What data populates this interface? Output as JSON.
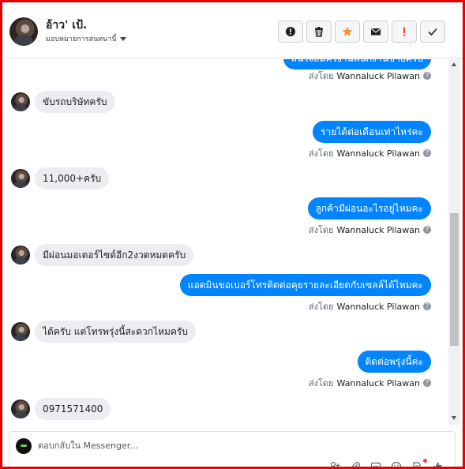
{
  "header": {
    "contact_name": "อ้าว' เป้.",
    "assign_label": "มอบหมายการสนทนานี้",
    "actions": [
      {
        "name": "report-button",
        "icon": "exclamation-circle-icon"
      },
      {
        "name": "delete-button",
        "icon": "trash-icon"
      },
      {
        "name": "star-button",
        "icon": "star-icon"
      },
      {
        "name": "mark-unread-button",
        "icon": "envelope-icon"
      },
      {
        "name": "spam-button",
        "icon": "exclamation-icon"
      },
      {
        "name": "done-button",
        "icon": "check-icon"
      }
    ]
  },
  "messages": [
    {
      "dir": "out",
      "text": "สนใจสมัครงานพนักงานขายครับ",
      "sent_by_prefix": "ส่งโดย",
      "sender": "Wannaluck Pilawan"
    },
    {
      "dir": "in",
      "text": "ขับรถบริษัทครับ"
    },
    {
      "dir": "out",
      "text": "รายได้ต่อเดือนเท่าไหร่คะ",
      "sent_by_prefix": "ส่งโดย",
      "sender": "Wannaluck Pilawan"
    },
    {
      "dir": "in",
      "text": "11,000+ครับ"
    },
    {
      "dir": "out",
      "text": "ลูกค้ามีผ่อนอะไรอยู่ไหมคะ",
      "sent_by_prefix": "ส่งโดย",
      "sender": "Wannaluck Pilawan"
    },
    {
      "dir": "in",
      "text": "มีผ่อนมอเตอร์ไซด์อีก2งวดหมดครับ"
    },
    {
      "dir": "out",
      "text": "แอดมินขอเบอร์โทรติดต่อคุยรายละเอียดกับเซลล์ได้ไหมคะ",
      "sent_by_prefix": "ส่งโดย",
      "sender": "Wannaluck Pilawan"
    },
    {
      "dir": "in",
      "text": "ได้ครับ แต่โทรพรุ่งนี้สะดวกไหมครับ"
    },
    {
      "dir": "out",
      "text": "ติดต่อพรุ่งนี้ค่ะ",
      "sent_by_prefix": "ส่งโดย",
      "sender": "Wannaluck Pilawan"
    },
    {
      "dir": "in",
      "text": "0971571400"
    }
  ],
  "composer": {
    "placeholder": "ตอบกลับใน Messenger..."
  },
  "colors": {
    "outgoing_bubble": "#0084ff",
    "incoming_bubble": "#ebedf0",
    "star": "#f7923a",
    "spam": "#e4443a",
    "frame": "#e30000"
  }
}
